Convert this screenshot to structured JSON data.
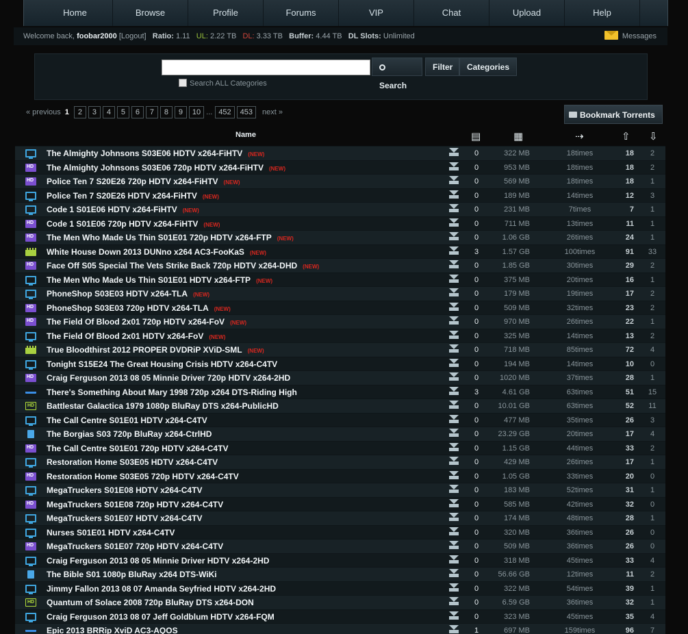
{
  "nav": [
    "Home",
    "Browse",
    "Profile",
    "Forums",
    "VIP",
    "Chat",
    "Upload",
    "Help"
  ],
  "userbar": {
    "welcome": "Welcome back,",
    "username": "foobar2000",
    "logout": "[Logout]",
    "ratio_label": "Ratio:",
    "ratio": "1.11",
    "ul_label": "UL:",
    "ul": "2.22 TB",
    "dl_label": "DL:",
    "dl": "3.33 TB",
    "buffer_label": "Buffer:",
    "buffer": "4.44 TB",
    "slots_label": "DL Slots:",
    "slots": "Unlimited",
    "messages": "Messages"
  },
  "search": {
    "value": "",
    "search_label": "Search",
    "filter_label": "Filter",
    "categories_label": "Categories",
    "all_categories_label": "Search ALL Categories"
  },
  "pager": {
    "prev": "« previous",
    "current": "1",
    "pages": [
      "2",
      "3",
      "4",
      "5",
      "6",
      "7",
      "8",
      "9",
      "10"
    ],
    "ellipsis": "...",
    "tail": [
      "452",
      "453"
    ],
    "next": "next »"
  },
  "bookmark_label": "Bookmark Torrents",
  "table": {
    "name_header": "Name",
    "new_label": "(NEW)",
    "rows": [
      {
        "cat": "tv",
        "name": "The Almighty Johnsons S03E06 HDTV x264-FiHTV",
        "new": true,
        "comments": "0",
        "size": "322 MB",
        "snatched": "18times",
        "seeders": "18",
        "leechers": "2"
      },
      {
        "cat": "hd",
        "name": "The Almighty Johnsons S03E06 720p HDTV x264-FiHTV",
        "new": true,
        "comments": "0",
        "size": "953 MB",
        "snatched": "18times",
        "seeders": "18",
        "leechers": "2"
      },
      {
        "cat": "hd",
        "name": "Police Ten 7 S20E26 720p HDTV x264-FiHTV",
        "new": true,
        "comments": "0",
        "size": "569 MB",
        "snatched": "18times",
        "seeders": "18",
        "leechers": "1"
      },
      {
        "cat": "tv",
        "name": "Police Ten 7 S20E26 HDTV x264-FiHTV",
        "new": true,
        "comments": "0",
        "size": "189 MB",
        "snatched": "14times",
        "seeders": "12",
        "leechers": "3"
      },
      {
        "cat": "tv",
        "name": "Code 1 S01E06 HDTV x264-FiHTV",
        "new": true,
        "comments": "0",
        "size": "231 MB",
        "snatched": "7times",
        "seeders": "7",
        "leechers": "1"
      },
      {
        "cat": "hd",
        "name": "Code 1 S01E06 720p HDTV x264-FiHTV",
        "new": true,
        "comments": "0",
        "size": "711 MB",
        "snatched": "13times",
        "seeders": "11",
        "leechers": "1"
      },
      {
        "cat": "hd",
        "name": "The Men Who Made Us Thin S01E01 720p HDTV x264-FTP",
        "new": true,
        "comments": "0",
        "size": "1.06 GB",
        "snatched": "26times",
        "seeders": "24",
        "leechers": "1"
      },
      {
        "cat": "movie",
        "name": "White House Down 2013 DUNno x264 AC3-FooKaS",
        "new": true,
        "comments": "3",
        "size": "1.57 GB",
        "snatched": "100times",
        "seeders": "91",
        "leechers": "33"
      },
      {
        "cat": "hd",
        "name": "Face Off S05 Special The Vets Strike Back 720p HDTV x264-DHD",
        "new": true,
        "comments": "0",
        "size": "1.85 GB",
        "snatched": "30times",
        "seeders": "29",
        "leechers": "2"
      },
      {
        "cat": "tv",
        "name": "The Men Who Made Us Thin S01E01 HDTV x264-FTP",
        "new": true,
        "comments": "0",
        "size": "375 MB",
        "snatched": "20times",
        "seeders": "16",
        "leechers": "1"
      },
      {
        "cat": "tv",
        "name": "PhoneShop S03E03 HDTV x264-TLA",
        "new": true,
        "comments": "0",
        "size": "179 MB",
        "snatched": "19times",
        "seeders": "17",
        "leechers": "2"
      },
      {
        "cat": "hd",
        "name": "PhoneShop S03E03 720p HDTV x264-TLA",
        "new": true,
        "comments": "0",
        "size": "509 MB",
        "snatched": "32times",
        "seeders": "23",
        "leechers": "2"
      },
      {
        "cat": "hd",
        "name": "The Field Of Blood 2x01 720p HDTV x264-FoV",
        "new": true,
        "comments": "0",
        "size": "970 MB",
        "snatched": "26times",
        "seeders": "22",
        "leechers": "1"
      },
      {
        "cat": "tv",
        "name": "The Field Of Blood 2x01 HDTV x264-FoV",
        "new": true,
        "comments": "0",
        "size": "325 MB",
        "snatched": "14times",
        "seeders": "13",
        "leechers": "2"
      },
      {
        "cat": "movie",
        "name": "True Bloodthirst 2012 PROPER DVDRiP XViD-SML",
        "new": true,
        "comments": "0",
        "size": "718 MB",
        "snatched": "85times",
        "seeders": "72",
        "leechers": "4"
      },
      {
        "cat": "tv",
        "name": "Tonight S15E24 The Great Housing Crisis HDTV x264-C4TV",
        "new": false,
        "comments": "0",
        "size": "194 MB",
        "snatched": "14times",
        "seeders": "10",
        "leechers": "0"
      },
      {
        "cat": "hd",
        "name": "Craig Ferguson 2013 08 05 Minnie Driver 720p HDTV x264-2HD",
        "new": false,
        "comments": "0",
        "size": "1020 MB",
        "snatched": "37times",
        "seeders": "28",
        "leechers": "1"
      },
      {
        "cat": "bluray",
        "name": "There's Something About Mary 1998 720p x264 DTS-Riding High",
        "new": false,
        "comments": "3",
        "size": "4.61 GB",
        "snatched": "63times",
        "seeders": "51",
        "leechers": "15"
      },
      {
        "cat": "hdmovie",
        "name": "Battlestar Galactica 1979 1080p BluRay DTS x264-PublicHD",
        "new": false,
        "comments": "0",
        "size": "10.01 GB",
        "snatched": "63times",
        "seeders": "52",
        "leechers": "11"
      },
      {
        "cat": "tv",
        "name": "The Call Centre S01E01 HDTV x264-C4TV",
        "new": false,
        "comments": "0",
        "size": "477 MB",
        "snatched": "35times",
        "seeders": "26",
        "leechers": "3"
      },
      {
        "cat": "box",
        "name": "The Borgias S03 720p BluRay x264-CtrlHD",
        "new": false,
        "comments": "0",
        "size": "23.29 GB",
        "snatched": "20times",
        "seeders": "17",
        "leechers": "4"
      },
      {
        "cat": "hd",
        "name": "The Call Centre S01E01 720p HDTV x264-C4TV",
        "new": false,
        "comments": "0",
        "size": "1.15 GB",
        "snatched": "44times",
        "seeders": "33",
        "leechers": "2"
      },
      {
        "cat": "tv",
        "name": "Restoration Home S03E05 HDTV x264-C4TV",
        "new": false,
        "comments": "0",
        "size": "429 MB",
        "snatched": "26times",
        "seeders": "17",
        "leechers": "1"
      },
      {
        "cat": "hd",
        "name": "Restoration Home S03E05 720p HDTV x264-C4TV",
        "new": false,
        "comments": "0",
        "size": "1.05 GB",
        "snatched": "33times",
        "seeders": "20",
        "leechers": "0"
      },
      {
        "cat": "tv",
        "name": "MegaTruckers S01E08 HDTV x264-C4TV",
        "new": false,
        "comments": "0",
        "size": "183 MB",
        "snatched": "52times",
        "seeders": "31",
        "leechers": "1"
      },
      {
        "cat": "hd",
        "name": "MegaTruckers S01E08 720p HDTV x264-C4TV",
        "new": false,
        "comments": "0",
        "size": "585 MB",
        "snatched": "42times",
        "seeders": "32",
        "leechers": "0"
      },
      {
        "cat": "tv",
        "name": "MegaTruckers S01E07 HDTV x264-C4TV",
        "new": false,
        "comments": "0",
        "size": "174 MB",
        "snatched": "48times",
        "seeders": "28",
        "leechers": "1"
      },
      {
        "cat": "tv",
        "name": "Nurses S01E01 HDTV x264-C4TV",
        "new": false,
        "comments": "0",
        "size": "320 MB",
        "snatched": "36times",
        "seeders": "26",
        "leechers": "0"
      },
      {
        "cat": "hd",
        "name": "MegaTruckers S01E07 720p HDTV x264-C4TV",
        "new": false,
        "comments": "0",
        "size": "509 MB",
        "snatched": "36times",
        "seeders": "26",
        "leechers": "0"
      },
      {
        "cat": "tv",
        "name": "Craig Ferguson 2013 08 05 Minnie Driver HDTV x264-2HD",
        "new": false,
        "comments": "0",
        "size": "318 MB",
        "snatched": "45times",
        "seeders": "33",
        "leechers": "4"
      },
      {
        "cat": "box",
        "name": "The Bible S01 1080p BluRay x264 DTS-WiKi",
        "new": false,
        "comments": "0",
        "size": "56.66 GB",
        "snatched": "12times",
        "seeders": "11",
        "leechers": "2"
      },
      {
        "cat": "tv",
        "name": "Jimmy Fallon 2013 08 07 Amanda Seyfried HDTV x264-2HD",
        "new": false,
        "comments": "0",
        "size": "322 MB",
        "snatched": "54times",
        "seeders": "39",
        "leechers": "1"
      },
      {
        "cat": "hdmovie",
        "name": "Quantum of Solace 2008 720p BluRay DTS x264-DON",
        "new": false,
        "comments": "0",
        "size": "6.59 GB",
        "snatched": "36times",
        "seeders": "32",
        "leechers": "1"
      },
      {
        "cat": "tv",
        "name": "Craig Ferguson 2013 08 07 Jeff Goldblum HDTV x264-FQM",
        "new": false,
        "comments": "0",
        "size": "323 MB",
        "snatched": "45times",
        "seeders": "35",
        "leechers": "4"
      },
      {
        "cat": "bluray",
        "name": "Epic 2013 BRRip XviD AC3-AQOS",
        "new": false,
        "comments": "1",
        "size": "697 MB",
        "snatched": "159times",
        "seeders": "96",
        "leechers": "7"
      }
    ]
  }
}
